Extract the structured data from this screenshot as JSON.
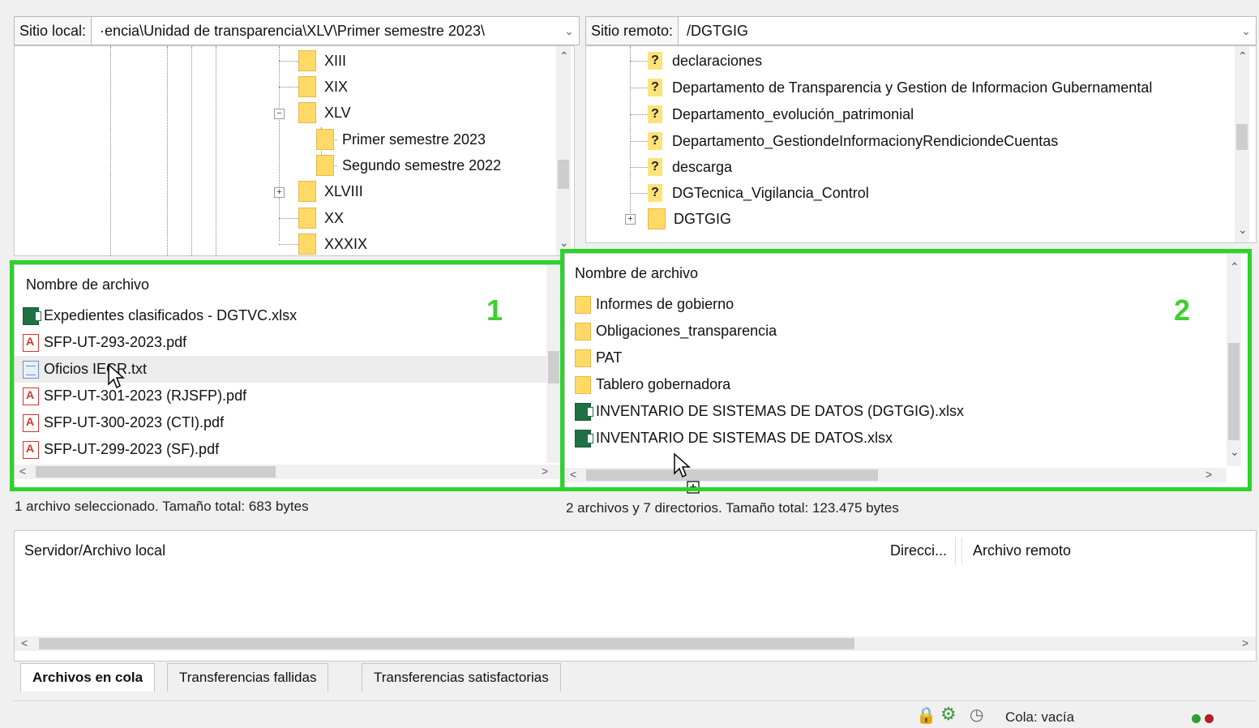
{
  "local": {
    "site_label": "Sitio local:",
    "path": "·encia\\Unidad de transparencia\\XLV\\Primer semestre 2023\\",
    "tree": [
      "XIII",
      "XIX",
      "XLV",
      "Primer semestre 2023",
      "Segundo semestre 2022",
      "XLVIII",
      "XX",
      "XXXIX"
    ],
    "list_header": "Nombre de archivo",
    "files": [
      {
        "name": "Expedientes clasificados - DGTVC.xlsx",
        "icon": "excel-file-icon"
      },
      {
        "name": "SFP-UT-293-2023.pdf",
        "icon": "pdf-file-icon"
      },
      {
        "name": "Oficios IECR.txt",
        "icon": "text-file-icon"
      },
      {
        "name": "SFP-UT-301-2023 (RJSFP).pdf",
        "icon": "pdf-file-icon"
      },
      {
        "name": "SFP-UT-300-2023 (CTI).pdf",
        "icon": "pdf-file-icon"
      },
      {
        "name": "SFP-UT-299-2023 (SF).pdf",
        "icon": "pdf-file-icon"
      }
    ],
    "status": "1 archivo seleccionado. Tamaño total: 683 bytes"
  },
  "remote": {
    "site_label": "Sitio remoto:",
    "path": "/DGTGIG",
    "tree": [
      "declaraciones",
      "Departamento de Transparencia y Gestion de Informacion Gubernamental",
      "Departamento_evolución_patrimonial",
      "Departamento_GestiondeInformacionyRendiciondeCuentas",
      "descarga",
      "DGTecnica_Vigilancia_Control",
      "DGTGIG"
    ],
    "list_header": "Nombre de archivo",
    "files": [
      {
        "name": "Informes de gobierno",
        "icon": "folder-icon"
      },
      {
        "name": "Obligaciones_transparencia",
        "icon": "folder-icon"
      },
      {
        "name": "PAT",
        "icon": "folder-icon"
      },
      {
        "name": "Tablero gobernadora",
        "icon": "folder-icon"
      },
      {
        "name": "INVENTARIO DE SISTEMAS DE DATOS (DGTGIG).xlsx",
        "icon": "excel-file-icon"
      },
      {
        "name": "INVENTARIO DE SISTEMAS DE DATOS.xlsx",
        "icon": "excel-file-icon"
      }
    ],
    "status": "2 archivos y 7 directorios. Tamaño total: 123.475 bytes"
  },
  "annotations": {
    "left": "1",
    "right": "2",
    "color": "#2bd42b"
  },
  "queue": {
    "col_local": "Servidor/Archivo local",
    "col_direction": "Direcci...",
    "col_remote": "Archivo remoto",
    "tabs": [
      "Archivos en cola",
      "Transferencias fallidas",
      "Transferencias satisfactorias"
    ],
    "active_tab": "Archivos en cola",
    "status": "Cola: vacía"
  }
}
